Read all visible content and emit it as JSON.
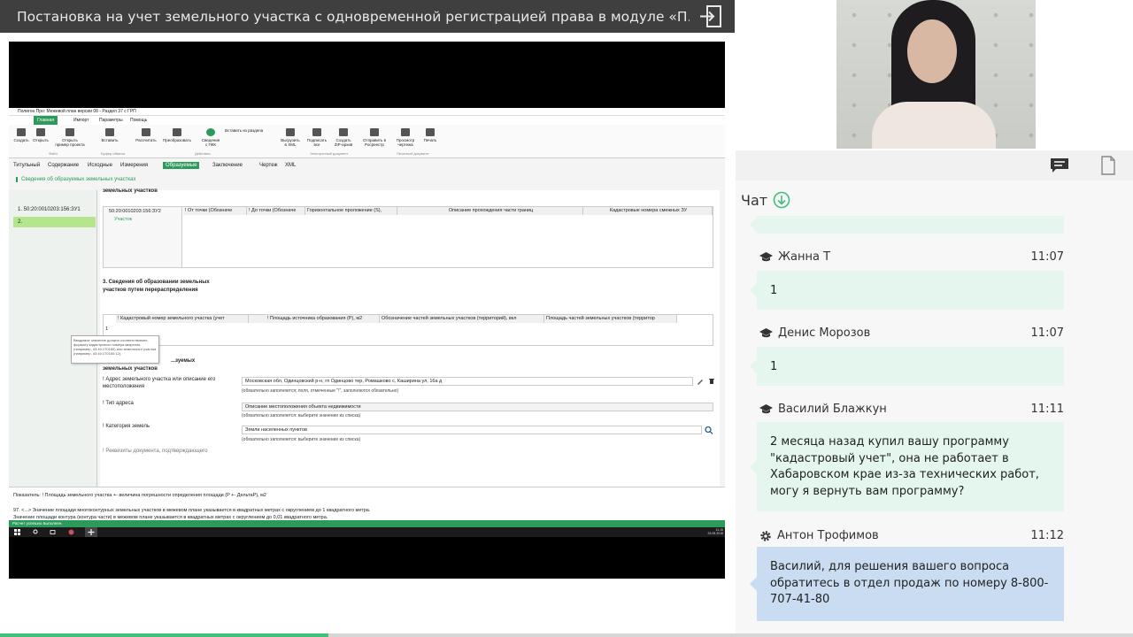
{
  "header": {
    "title": "Постановка на учет земельного участка с одновременной регистрацией права в модуле «П...",
    "exit_icon": "exit-icon"
  },
  "screen": {
    "app_title": "Полигон Про: Межевой план версии 08 - Раздел 37 с ГРП",
    "ribbon_tabs": [
      "Главная",
      "Импорт",
      "Параметры",
      "Помощь"
    ],
    "ribbon_buttons": [
      "Создать",
      "Открыть",
      "Открыть пример проекта",
      "Вставить",
      "Рассчитать",
      "Преобразовать",
      "Сведения с ПКК",
      "Вставить из раздела",
      "Выгрузить в XML",
      "Подписать все",
      "Создать ZIP-архив",
      "Отправить в Росреестр",
      "Просмотр чертежа",
      "Печать"
    ],
    "ribbon_groups": [
      "Файл",
      "Буфер обмена",
      "Действия",
      "Электронный документ",
      "Печатный документ"
    ],
    "section_tabs": [
      "Титульный",
      "Содержание",
      "Исходные",
      "Измерения",
      "Образуемые",
      "Заключение",
      "Чертеж",
      "XML"
    ],
    "active_section": "Образуемые",
    "subtitle": "Сведения об образуемых земельных участках",
    "left_items": [
      "1.  50:20:0010203:156:ЗУ1",
      "2."
    ],
    "panel_top_label": "земельных участков",
    "table1": {
      "tree": [
        "50:20:0010203:156:ЗУ2",
        "Участок"
      ],
      "headers": [
        "! От точки (Обозначе",
        "! До точки (Обозначе",
        "Горизонтальное проложение (S),",
        "Описание прохождения части границ",
        "Кадастровые номера смежных ЗУ"
      ]
    },
    "section3": "3. Сведения об образовании земельных участков путем перераспределения",
    "table2": {
      "headers": [
        "! Кадастровый номер земельного участка (учет",
        "! Площадь источника образования (P), м2",
        "Обозначение частей земельных участков (территорий), вкл",
        "Площадь частей земельных участков (территор"
      ],
      "row": "1"
    },
    "tooltip": "Вводимое значение должно соответствовать формату кадастрового номера квартала (например, 43:40:170160) или земельного участка (например, 43:40:170160:12).",
    "section4_a": "...зуемых",
    "section4_b": "земельных участков",
    "fields": [
      {
        "label": "! Адрес земельного участка или описание его местоположения",
        "value": "Московская обл, Одинцовский р-н, гп Одинцово тер, Ромашково с, Каширина ул, 16а д",
        "hint": "(обязательно заполняется; поля, отмеченные \"!\", заполняются обязательно)"
      },
      {
        "label": "! Тип адреса",
        "value": "Описание местоположения объекта недвижимости",
        "hint": "(обязательно заполняется: выберите значение из списка)"
      },
      {
        "label": "! Категория земель",
        "value": "Земли населенных пунктов",
        "hint": "(обязательно заполняется: выберите значение из списка)"
      }
    ],
    "cut_label": "! Реквизиты документа, подтверждающего",
    "info_line1": "Показатель: ! Площадь земельного участка +- величина погрешности определения площади (P +- ДельтаP), м2",
    "info_line2": "97. <...> Значение площади многоконтурных земельных участков в межевом плане указывается в квадратных метрах с округлением до 1 квадратного метра.",
    "info_line3": "Значение площади контура (контура части) в межевом плане указывается в квадратных метрах с округлением до 0,01 квадратного метра.",
    "status": "Расчет успешно выполнен.",
    "clock_time": "11:15",
    "clock_date": "23.05.2018"
  },
  "chat": {
    "title": "Чат",
    "messages": [
      {
        "name": "Жанна Т",
        "time": "11:07",
        "text": "1",
        "role": "student"
      },
      {
        "name": "Денис Морозов",
        "time": "11:07",
        "text": "1",
        "role": "student"
      },
      {
        "name": "Василий Блажкун",
        "time": "11:11",
        "text": "2 месяца назад купил вашу программу \"кадастровый учет\", она не работает в Хабаровском крае из-за технических работ, могу я вернуть вам программу?",
        "role": "student"
      },
      {
        "name": "Антон Трофимов",
        "time": "11:12",
        "text": "Василий, для решения вашего вопроса обратитесь в отдел продаж по номеру 8-800-707-41-80",
        "role": "staff"
      }
    ]
  },
  "colors": {
    "accent": "#3fbf7a",
    "app_green": "#2b9a5a",
    "student_bubble": "#e4f6ee",
    "staff_bubble": "#c9dcf2",
    "titlebar": "#3f3f3f"
  },
  "progress": 0.29
}
